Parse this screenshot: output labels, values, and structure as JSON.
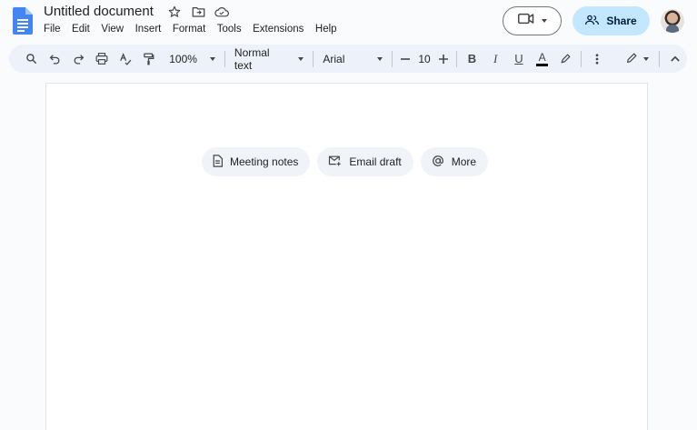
{
  "document": {
    "title": "Untitled document"
  },
  "menu": {
    "items": [
      "File",
      "Edit",
      "View",
      "Insert",
      "Format",
      "Tools",
      "Extensions",
      "Help"
    ]
  },
  "header": {
    "share_label": "Share"
  },
  "toolbar": {
    "zoom": "100%",
    "style": "Normal text",
    "font": "Arial",
    "font_size": "10",
    "bold": "B",
    "italic": "I",
    "underline": "U",
    "text_color_letter": "A"
  },
  "chips": [
    {
      "label": "Meeting notes",
      "icon": "document-icon"
    },
    {
      "label": "Email draft",
      "icon": "email-draft-icon"
    },
    {
      "label": "More",
      "icon": "at-sign-icon"
    }
  ],
  "colors": {
    "accent": "#1a73e8",
    "share_bg": "#c2e7ff",
    "toolbar_bg": "#edf2fa"
  }
}
